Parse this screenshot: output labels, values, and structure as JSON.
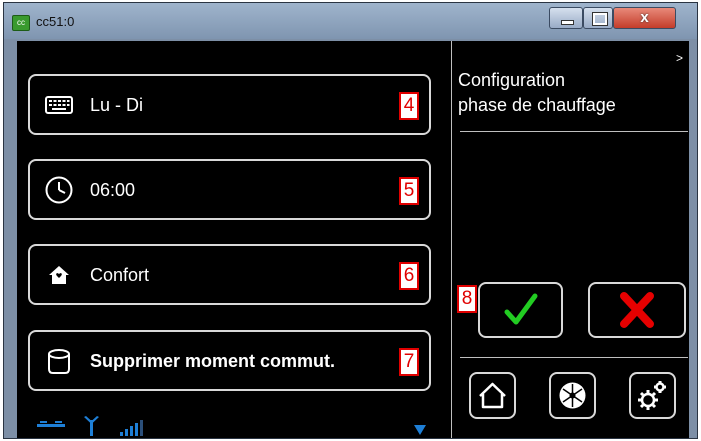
{
  "window": {
    "title": "cc51:0",
    "app_icon": "cc-app-icon",
    "close_label": "x"
  },
  "rows": [
    {
      "label": "Lu - Di",
      "icon": "keyboard-icon",
      "badge": "4"
    },
    {
      "label": "06:00",
      "icon": "clock-icon",
      "badge": "5"
    },
    {
      "label": "Confort",
      "icon": "home-comfort-icon",
      "badge": "6"
    },
    {
      "label": "Supprimer moment commut.",
      "icon": "delete-cylinder-icon",
      "badge": "7"
    }
  ],
  "panel": {
    "title_line1": "Configuration",
    "title_line2": "phase de chauffage",
    "expand_label": ">",
    "confirm_badge": "8"
  },
  "status_bar": {
    "icons": [
      "link-icon",
      "antenna-icon",
      "signal-bars-icon",
      "scroll-down-icon"
    ]
  },
  "colors": {
    "background": "#000000",
    "border": "#d9d9d9",
    "check": "#22cc22",
    "cross": "#e60000",
    "status": "#1e7fd6",
    "badge": "#e00000"
  }
}
